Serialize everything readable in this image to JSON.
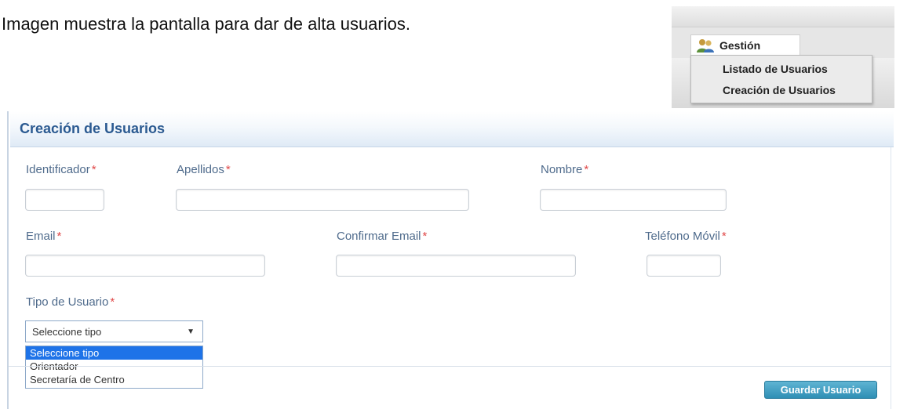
{
  "caption": "Imagen  muestra la pantalla para dar de alta usuarios.",
  "menu": {
    "gestion_label": "Gestión",
    "items": [
      "Listado de Usuarios",
      "Creación de Usuarios"
    ]
  },
  "form": {
    "title": "Creación de Usuarios",
    "required_mark": "*",
    "fields": {
      "identificador": {
        "label": "Identificador",
        "value": ""
      },
      "apellidos": {
        "label": "Apellidos",
        "value": ""
      },
      "nombre": {
        "label": "Nombre",
        "value": ""
      },
      "email": {
        "label": "Email",
        "value": ""
      },
      "confirmar_email": {
        "label": "Confirmar Email",
        "value": ""
      },
      "telefono": {
        "label": "Teléfono Móvil",
        "value": ""
      }
    },
    "tipo_usuario": {
      "label": "Tipo de Usuario",
      "selected": "Seleccione tipo",
      "options": [
        "Seleccione tipo",
        "Orientador",
        "Secretaría de Centro"
      ]
    },
    "save_label": "Guardar Usuario"
  },
  "colors": {
    "title": "#2b5a91",
    "label": "#4f6b8c",
    "required": "#e04848",
    "option_highlight": "#1e73e8",
    "save_button": "#2f8fb5"
  },
  "icons": {
    "gestion": "users-icon",
    "select_arrow": "dropdown-arrow-icon"
  }
}
